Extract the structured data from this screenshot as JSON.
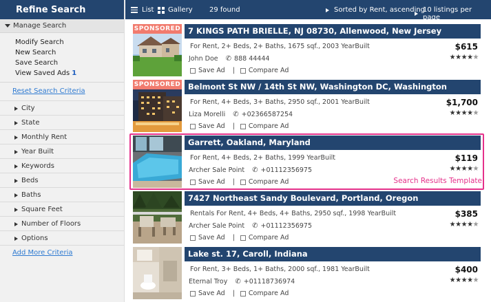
{
  "sidebar": {
    "title": "Refine Search",
    "manage_label": "Manage Search",
    "manage_items": [
      {
        "label": "Modify Search"
      },
      {
        "label": "New Search"
      },
      {
        "label": "Save Search"
      },
      {
        "label": "View Saved Ads",
        "count": "1"
      }
    ],
    "reset_label": "Reset Search Criteria",
    "criteria": [
      {
        "label": "City"
      },
      {
        "label": "State"
      },
      {
        "label": "Monthly Rent"
      },
      {
        "label": "Year Built"
      },
      {
        "label": "Keywords"
      },
      {
        "label": "Beds"
      },
      {
        "label": "Baths"
      },
      {
        "label": "Square Feet"
      },
      {
        "label": "Number of Floors"
      },
      {
        "label": "Options"
      }
    ],
    "add_more_label": "Add More Criteria"
  },
  "toolbar": {
    "list_label": "List",
    "gallery_label": "Gallery",
    "found_text": "29 found",
    "sort_text": "Sorted by Rent, ascending",
    "per_page_text": "10 listings per page"
  },
  "listings": [
    {
      "sponsored": "SPONSORED",
      "title": "7 KINGS PATH BRIELLE, NJ 08730, Allenwood, New Jersey",
      "details": "For Rent, 2+ Beds, 2+ Baths, 1675 sqf., 2003 YearBuilt",
      "agent": "John Doe",
      "phone": "888 44444",
      "price": "$615",
      "rating": 4,
      "save_label": "Save Ad",
      "compare_label": "Compare Ad",
      "pipe": "|"
    },
    {
      "sponsored": "SPONSORED",
      "title": "Belmont St NW / 14th St NW, Washington DC, Washington",
      "details": "For Rent, 4+ Beds, 3+ Baths, 2950 sqf., 2001 YearBuilt",
      "agent": "Liza Morelli",
      "phone": "+02366587254",
      "price": "$1,700",
      "rating": 4,
      "save_label": "Save Ad",
      "compare_label": "Compare Ad",
      "pipe": "|"
    },
    {
      "title": "Garrett, Oakland, Maryland",
      "details": "For Rent, 4+ Beds, 2+ Baths, 1999 YearBuilt",
      "agent": "Archer Sale Point",
      "phone": "+01112356975",
      "price": "$119",
      "rating": 4,
      "save_label": "Save Ad",
      "compare_label": "Compare Ad",
      "pipe": "|"
    },
    {
      "title": "7427 Northeast Sandy Boulevard, Portland, Oregon",
      "details": "Rentals For Rent, 4+ Beds, 4+ Baths, 2950 sqf., 1998 YearBuilt",
      "agent": "Archer Sale Point",
      "phone": "+01112356975",
      "price": "$385",
      "rating": 4,
      "save_label": "Save Ad",
      "compare_label": "Compare Ad",
      "pipe": "|"
    },
    {
      "title": "Lake st. 17, Caroll, Indiana",
      "details": "For Rent, 3+ Beds, 1+ Baths, 2000 sqf., 1981 YearBuilt",
      "agent": "Eternal Troy",
      "phone": "+01118736974",
      "price": "$400",
      "rating": 4,
      "save_label": "Save Ad",
      "compare_label": "Compare Ad",
      "pipe": "|"
    }
  ],
  "highlight_label": "Search Results Template",
  "colors": {
    "header_blue": "#23456f",
    "sponsored_red": "#f17b6e",
    "link_blue": "#2e7ad1",
    "highlight_pink": "#e5308a"
  }
}
